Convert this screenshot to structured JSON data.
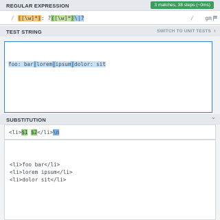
{
  "regex": {
    "header": "REGULAR EXPRESSION",
    "status": "3 matches, 38 steps (~0ms)",
    "open_delim": "/",
    "close_delim": "/",
    "flags": "gm",
    "pattern": {
      "g1_open": "(",
      "g1_body": "[\\w]*",
      "g1_close": ")",
      "sep": ": ",
      "q": "?",
      "g2_open": "(",
      "g2_body": "[\\w]*",
      "g2_close": ")",
      "g3": "\\|?"
    }
  },
  "test": {
    "header": "TEST STRING",
    "switch_label": "SWITCH TO UNIT TESTS",
    "chevron": "›",
    "segments": [
      "foo: bar",
      "|",
      "lorem",
      "|",
      "ipsum",
      "|",
      "dolor: sit"
    ]
  },
  "substitution": {
    "header": "SUBSTITUTION",
    "chevron": "⌄",
    "parts": [
      "<li>",
      "$1",
      " ",
      "$2",
      "</li>",
      "\\n"
    ],
    "result_lines": [
      "<li>foo bar</li>",
      "<li>lorem ipsum</li>",
      "<li>dolor sit</li>"
    ]
  }
}
